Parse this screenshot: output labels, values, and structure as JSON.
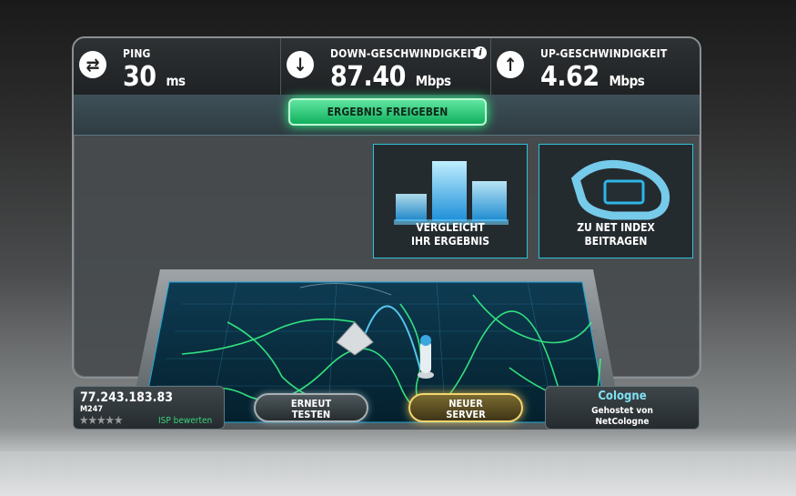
{
  "stats": {
    "ping": {
      "label": "PING",
      "value": "30",
      "unit": "ms"
    },
    "download": {
      "label": "DOWN-GESCHWINDIGKEIT",
      "value": "87.40",
      "unit": "Mbps"
    },
    "upload": {
      "label": "UP-GESCHWINDIGKEIT",
      "value": "4.62",
      "unit": "Mbps"
    }
  },
  "info_icon": "i",
  "share_button": "ERGEBNIS FREIGEBEN",
  "cards": {
    "compare": {
      "line1": "VERGLEICHT",
      "line2": "IHR ERGEBNIS"
    },
    "netindex": {
      "line1": "ZU NET INDEX",
      "line2": "BEITRAGEN"
    }
  },
  "client": {
    "ip": "77.243.183.83",
    "code": "M247",
    "stars": "★★★★★",
    "rate_label": "ISP bewerten"
  },
  "buttons": {
    "retest_line1": "ERNEUT",
    "retest_line2": "TESTEN",
    "new_server_line1": "NEUER",
    "new_server_line2": "SERVER"
  },
  "server": {
    "city": "Cologne",
    "hosted_line1": "Gehostet von",
    "hosted_line2": "NetCologne"
  },
  "icons": {
    "ping": "ping-arrows-icon",
    "download": "download-arrow-icon",
    "upload": "upload-arrow-icon"
  },
  "colors": {
    "accent_green": "#2bff8a",
    "accent_cyan": "#2fc1d8",
    "server_gold": "#f5d56e",
    "rate_green": "#39d47c"
  }
}
